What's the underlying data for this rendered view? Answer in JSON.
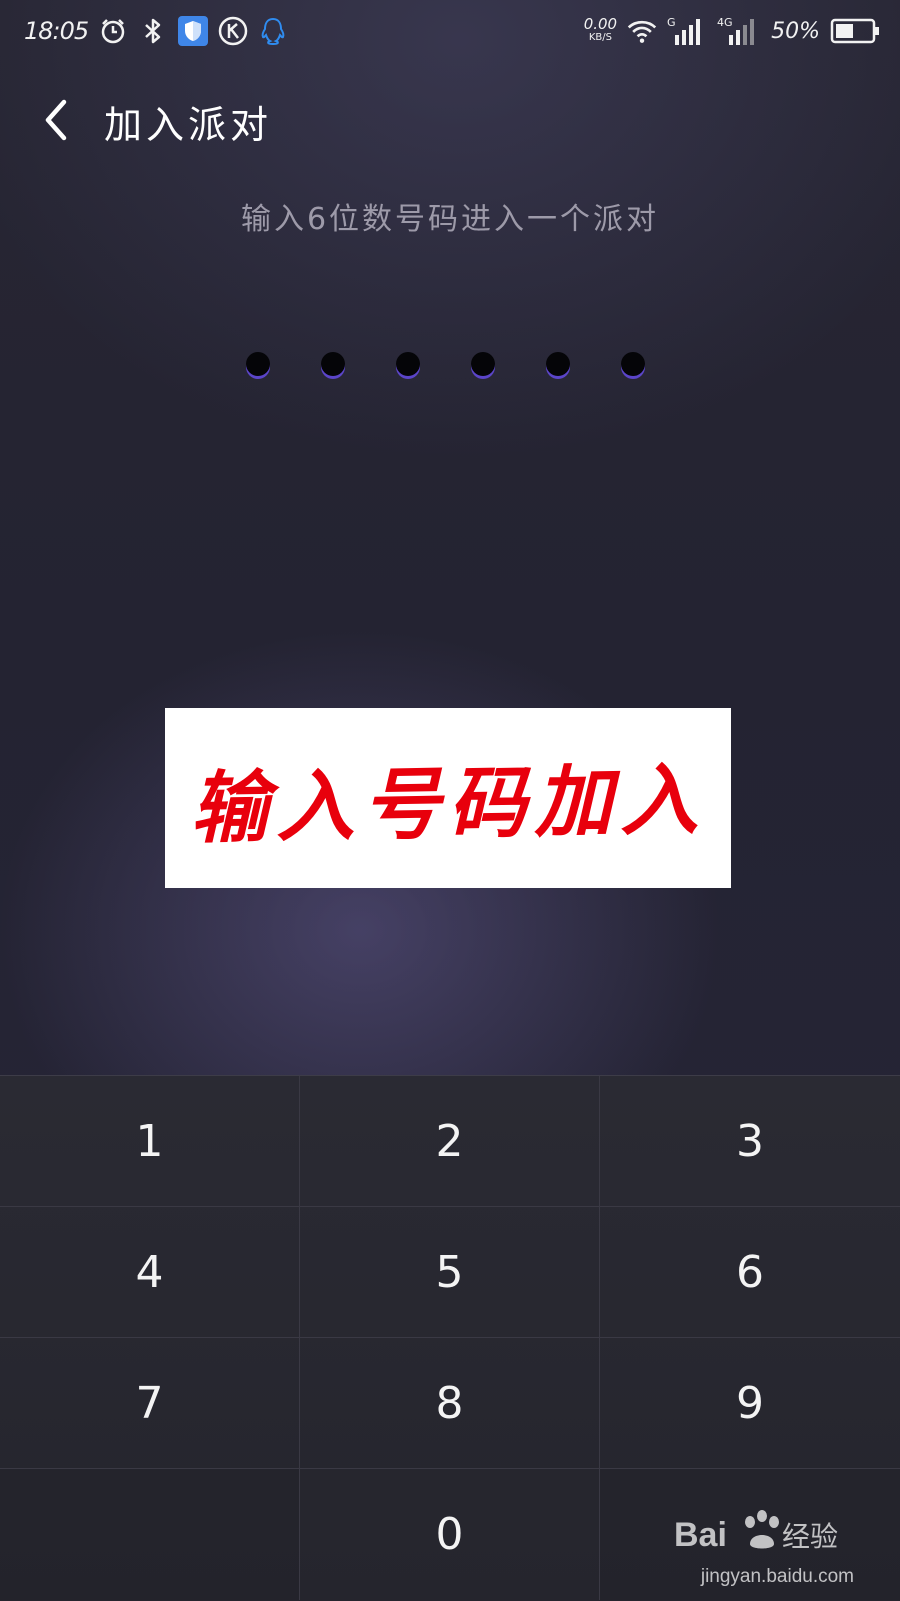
{
  "status_bar": {
    "time": "18:05",
    "net_speed_value": "0.00",
    "net_speed_unit": "KB/S",
    "signal_1_label": "G",
    "signal_2_label": "4G",
    "battery_percent": "50%",
    "battery_level": 0.5,
    "left_icons": [
      "alarm-icon",
      "bluetooth-icon",
      "shield-app-icon",
      "k-app-icon",
      "qq-icon"
    ],
    "right_icons": [
      "wifi-icon",
      "signal-icon",
      "signal-icon",
      "battery-icon"
    ]
  },
  "header": {
    "title": "加入派对",
    "back_icon": "chevron-left-icon"
  },
  "instruction": "输入6位数号码进入一个派对",
  "code": {
    "length": 6,
    "entered": 0,
    "dot_color": "#050508",
    "underline_color": "#5b45c9"
  },
  "banner": {
    "text": "输入号码加入",
    "text_color": "#e8000c"
  },
  "keypad": {
    "keys": [
      "1",
      "2",
      "3",
      "4",
      "5",
      "6",
      "7",
      "8",
      "9",
      "",
      "0",
      ""
    ]
  },
  "watermark": {
    "url": "jingyan.baidu.com",
    "logo_text": "Bai",
    "logo_text_2": "经验"
  }
}
